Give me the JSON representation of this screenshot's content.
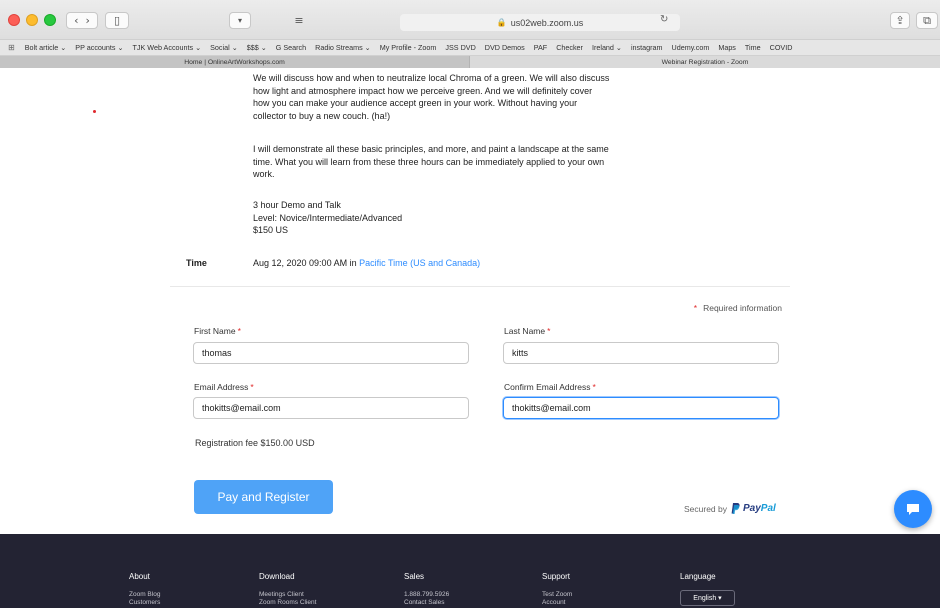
{
  "browser": {
    "address": "us02web.zoom.us",
    "tabs": [
      "Home | OnlineArtWorkshops.com",
      "Webinar Registration - Zoom"
    ],
    "bookmarks": [
      "Bolt article ⌄",
      "PP accounts ⌄",
      "TJK Web Accounts ⌄",
      "Social ⌄",
      "$$$ ⌄",
      "G Search",
      "Radio Streams ⌄",
      "My Profile - Zoom",
      "JSS DVD",
      "DVD Demos",
      "PAF",
      "Checker",
      "Ireland ⌄",
      "instagram",
      "Udemy.com",
      "Maps",
      "Time",
      "COVID"
    ]
  },
  "description": {
    "p1": [
      "We will discuss how and when to neutralize local Chroma of a green. We will also discuss",
      "how light and atmosphere impact how we perceive green. And we will definitely cover",
      "how you can make your audience accept green in your work. Without having your",
      "collector to buy a new couch. (ha!)"
    ],
    "p2": [
      "I will demonstrate all these basic principles, and more, and paint a landscape at the same",
      "time. What you will learn from these three hours can be immediately applied to your own",
      "work."
    ],
    "p3": [
      "3 hour Demo and Talk",
      "Level: Novice/Intermediate/Advanced",
      "$150 US"
    ]
  },
  "time": {
    "label": "Time",
    "value": "Aug 12, 2020 09:00 AM in ",
    "tz_link": "Pacific Time (US and Canada)"
  },
  "form": {
    "required_note": "Required information",
    "first_name": {
      "label": "First Name",
      "value": "thomas"
    },
    "last_name": {
      "label": "Last Name",
      "value": "kitts"
    },
    "email": {
      "label": "Email Address",
      "value": "thokitts@email.com"
    },
    "confirm_email": {
      "label": "Confirm Email Address",
      "value": "thokitts@email.com"
    },
    "fee": "Registration fee $150.00 USD",
    "submit_label": "Pay and Register",
    "secured_by": "Secured by",
    "paypal_pay": "Pay",
    "paypal_pal": "Pal"
  },
  "footer": {
    "columns": [
      {
        "head": "About",
        "links": [
          "Zoom Blog",
          "Customers"
        ]
      },
      {
        "head": "Download",
        "links": [
          "Meetings Client",
          "Zoom Rooms Client"
        ]
      },
      {
        "head": "Sales",
        "links": [
          "1.888.799.5926",
          "Contact Sales"
        ]
      },
      {
        "head": "Support",
        "links": [
          "Test Zoom",
          "Account"
        ]
      },
      {
        "head": "Language",
        "links": []
      }
    ],
    "language_value": "English ▾"
  },
  "colors": {
    "accent": "#2d8cff",
    "button": "#4fa3f7",
    "footer": "#232333",
    "required": "#e02828"
  }
}
